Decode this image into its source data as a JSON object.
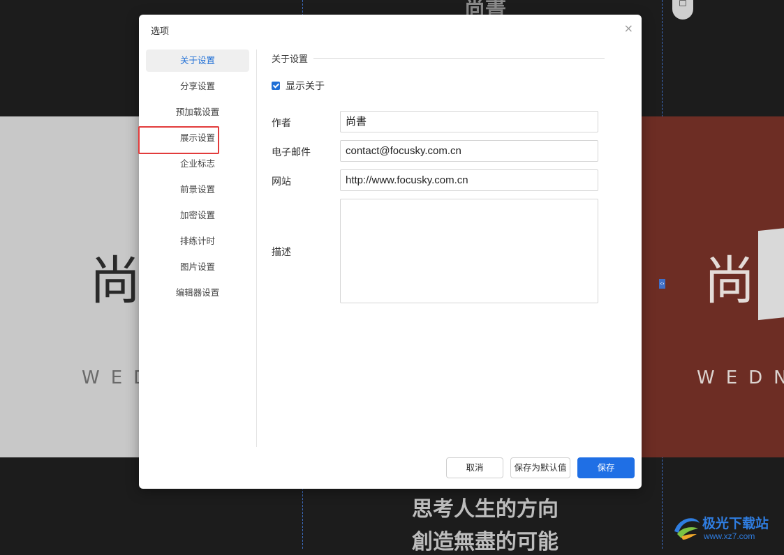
{
  "background": {
    "top_title": "尚書",
    "left_glyph": "尚",
    "left_letters": "WED",
    "right_glyph": "尚",
    "right_letters": "WEDN",
    "bottom_line1": "思考人生的方向",
    "bottom_line2": "創造無盡的可能"
  },
  "dialog": {
    "title": "选项",
    "close_glyph": "×",
    "nav_items": [
      {
        "label": "关于设置",
        "active": true
      },
      {
        "label": "分享设置"
      },
      {
        "label": "预加载设置"
      },
      {
        "label": "展示设置",
        "highlighted": true
      },
      {
        "label": "企业标志"
      },
      {
        "label": "前景设置"
      },
      {
        "label": "加密设置"
      },
      {
        "label": "排练计时"
      },
      {
        "label": "图片设置"
      },
      {
        "label": "编辑器设置"
      }
    ],
    "section_title": "关于设置",
    "show_about": {
      "label": "显示关于",
      "checked": true
    },
    "fields": {
      "author": {
        "label": "作者",
        "value": "尚書"
      },
      "email": {
        "label": "电子邮件",
        "value": "contact@focusky.com.cn"
      },
      "website": {
        "label": "网站",
        "value": "http://www.focusky.com.cn"
      },
      "description": {
        "label": "描述",
        "value": ""
      }
    },
    "buttons": {
      "cancel": "取消",
      "save_default": "保存为默认值",
      "save": "保存"
    }
  },
  "watermark": {
    "name": "极光下载站",
    "url": "www.xz7.com"
  },
  "colors": {
    "accent": "#1f6fe5",
    "highlight_box": "#e23b3b",
    "canvas": "#1c1c1c"
  }
}
